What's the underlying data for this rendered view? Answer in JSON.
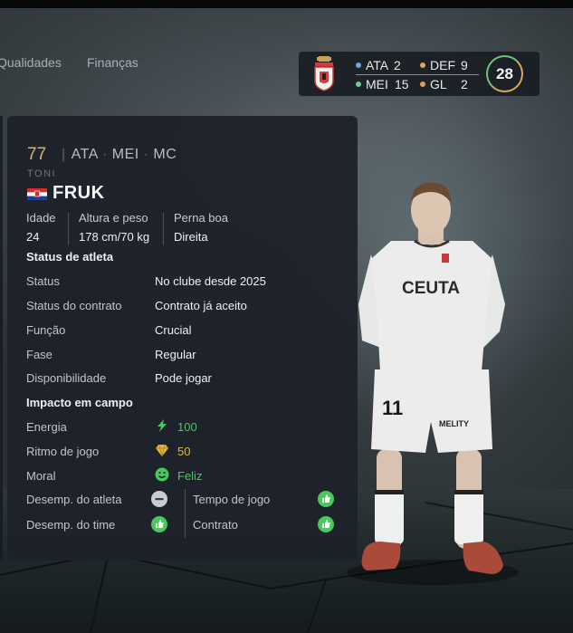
{
  "tabs": [
    {
      "label": "Qualidades"
    },
    {
      "label": "Finanças"
    }
  ],
  "team_summary": {
    "crest_icon": "club-crest-icon",
    "positions": [
      {
        "label": "ATA",
        "count": "2",
        "color": "#6aa6e0"
      },
      {
        "label": "DEF",
        "count": "9",
        "color": "#e0a85c"
      },
      {
        "label": "MEI",
        "count": "15",
        "color": "#7cc88a"
      },
      {
        "label": "GL",
        "count": "2",
        "color": "#e09a5c"
      }
    ],
    "total": "28"
  },
  "player": {
    "overall": "77",
    "positions": [
      "ATA",
      "MEI",
      "MC"
    ],
    "first_name": "TONI",
    "last_name": "FRUK",
    "flag_icon": "croatia-flag-icon",
    "info": [
      {
        "label": "Idade",
        "value": "24"
      },
      {
        "label": "Altura e peso",
        "value": "178 cm/70 kg"
      },
      {
        "label": "Perna boa",
        "value": "Direita"
      }
    ],
    "shirt_text": "CEUTA",
    "shirt_number": "11",
    "sponsor_text": "MELITY"
  },
  "athlete_status": {
    "title": "Status de atleta",
    "rows": [
      {
        "label": "Status",
        "value": "No clube desde 2025"
      },
      {
        "label": "Status do contrato",
        "value": "Contrato já aceito"
      },
      {
        "label": "Função",
        "value": "Crucial"
      },
      {
        "label": "Fase",
        "value": "Regular"
      },
      {
        "label": "Disponibilidade",
        "value": "Pode jogar"
      }
    ]
  },
  "field_impact": {
    "title": "Impacto em campo",
    "rows": [
      {
        "label": "Energia",
        "value": "100",
        "icon": "lightning-icon",
        "color": "#49c85e"
      },
      {
        "label": "Ritmo de jogo",
        "value": "50",
        "icon": "diamond-icon",
        "color": "#e3b53a"
      },
      {
        "label": "Moral",
        "value": "Feliz",
        "icon": "smiley-icon",
        "color": "#49c85e"
      }
    ],
    "performance": [
      {
        "label": "Desemp. do atleta",
        "icon": "neutral-icon"
      },
      {
        "label": "Tempo de jogo",
        "icon": "thumbs-up-icon"
      },
      {
        "label": "Desemp. do time",
        "icon": "thumbs-up-icon"
      },
      {
        "label": "Contrato",
        "icon": "thumbs-up-icon"
      }
    ]
  },
  "colors": {
    "overall": "#d8b26a",
    "positive": "#49c85e",
    "warning": "#e3b53a",
    "neutral": "#c8ccd0"
  }
}
